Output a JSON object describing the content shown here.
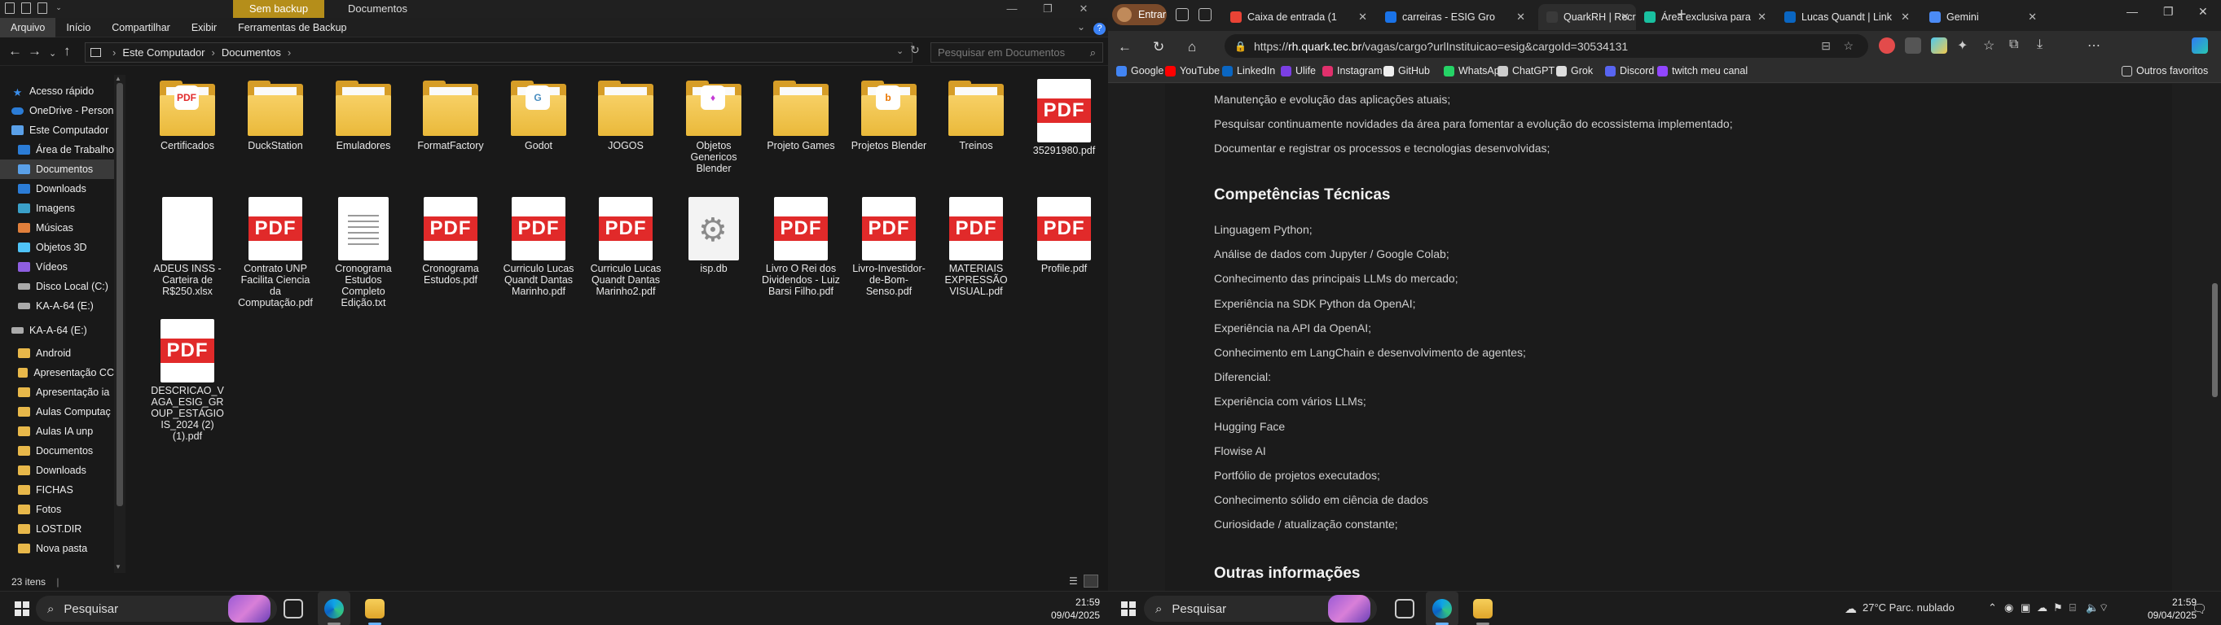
{
  "explorer": {
    "tab_label": "Sem backup",
    "window_title": "Documentos",
    "ribbon": [
      "Arquivo",
      "Início",
      "Compartilhar",
      "Exibir",
      "Ferramentas de Backup"
    ],
    "breadcrumb": [
      "Este Computador",
      "Documentos"
    ],
    "search_placeholder": "Pesquisar em Documentos",
    "status_count": "23 itens",
    "sidebar": [
      {
        "label": "Acesso rápido",
        "icon": "star-icon"
      },
      {
        "label": "OneDrive - Person",
        "icon": "cloud-icon"
      },
      {
        "label": "Este Computador",
        "icon": "computer-icon"
      },
      {
        "label": "Área de Trabalho",
        "icon": "desktop-icon"
      },
      {
        "label": "Documentos",
        "icon": "documents-icon"
      },
      {
        "label": "Downloads",
        "icon": "download-icon"
      },
      {
        "label": "Imagens",
        "icon": "images-icon"
      },
      {
        "label": "Músicas",
        "icon": "music-icon"
      },
      {
        "label": "Objetos 3D",
        "icon": "objects-3d-icon"
      },
      {
        "label": "Vídeos",
        "icon": "video-icon"
      },
      {
        "label": "Disco Local (C:)",
        "icon": "drive-icon"
      },
      {
        "label": "KA-A-64 (E:)",
        "icon": "drive-icon"
      },
      {
        "label": "KA-A-64 (E:)",
        "icon": "drive-icon"
      },
      {
        "label": "Android",
        "icon": "folder-icon"
      },
      {
        "label": "Apresentação CC",
        "icon": "folder-icon"
      },
      {
        "label": "Apresentação ia",
        "icon": "folder-icon"
      },
      {
        "label": "Aulas Computaç",
        "icon": "folder-icon"
      },
      {
        "label": "Aulas IA unp",
        "icon": "folder-icon"
      },
      {
        "label": "Documentos",
        "icon": "folder-icon"
      },
      {
        "label": "Downloads",
        "icon": "folder-icon"
      },
      {
        "label": "FICHAS",
        "icon": "folder-icon"
      },
      {
        "label": "Fotos",
        "icon": "folder-icon"
      },
      {
        "label": "LOST.DIR",
        "icon": "folder-icon"
      },
      {
        "label": "Nova pasta",
        "icon": "folder-icon"
      }
    ],
    "files": [
      {
        "name": "Certificados",
        "kind": "folder",
        "badge": "PDF",
        "badge_color": "#e12a2a"
      },
      {
        "name": "DuckStation",
        "kind": "folder",
        "badge": "",
        "badge_color": ""
      },
      {
        "name": "Emuladores",
        "kind": "folder",
        "badge": "",
        "badge_color": ""
      },
      {
        "name": "FormatFactory",
        "kind": "folder",
        "badge": "",
        "badge_color": ""
      },
      {
        "name": "Godot",
        "kind": "folder",
        "badge": "G",
        "badge_color": "#478cbf"
      },
      {
        "name": "JOGOS",
        "kind": "folder",
        "badge": "",
        "badge_color": ""
      },
      {
        "name": "Objetos Genericos Blender",
        "kind": "folder",
        "badge": "♦",
        "badge_color": "#c43bd6"
      },
      {
        "name": "Projeto Games",
        "kind": "folder",
        "badge": "",
        "badge_color": ""
      },
      {
        "name": "Projetos Blender",
        "kind": "folder",
        "badge": "b",
        "badge_color": "#ea7600"
      },
      {
        "name": "Treinos",
        "kind": "folder",
        "badge": "",
        "badge_color": ""
      },
      {
        "name": "35291980.pdf",
        "kind": "pdf"
      },
      {
        "name": "ADEUS INSS - Carteira de R$250.xlsx",
        "kind": "blank"
      },
      {
        "name": "Contrato UNP Facilita Ciencia da Computação.pdf",
        "kind": "pdf"
      },
      {
        "name": "Cronograma Estudos Completo Edição.txt",
        "kind": "text"
      },
      {
        "name": "Cronograma Estudos.pdf",
        "kind": "pdf"
      },
      {
        "name": "Curriculo Lucas Quandt Dantas Marinho.pdf",
        "kind": "pdf"
      },
      {
        "name": "Curriculo Lucas Quandt Dantas Marinho2.pdf",
        "kind": "pdf"
      },
      {
        "name": "isp.db",
        "kind": "gear"
      },
      {
        "name": "Livro O Rei dos Dividendos - Luiz Barsi Filho.pdf",
        "kind": "pdf"
      },
      {
        "name": "Livro-Investidor-de-Bom-Senso.pdf",
        "kind": "pdf"
      },
      {
        "name": "MATERIAIS EXPRESSÃO VISUAL.pdf",
        "kind": "pdf"
      },
      {
        "name": "Profile.pdf",
        "kind": "pdf"
      },
      {
        "name": "DESCRICAO_VAGA_ESIG_GROUP_ESTÁGIO IS_2024 (2) (1).pdf",
        "kind": "pdf"
      }
    ],
    "pdf_label": "PDF"
  },
  "browser": {
    "signin_label": "Entrar",
    "tabs": [
      {
        "title": "Caixa de entrada (1",
        "color": "#ea4335"
      },
      {
        "title": "carreiras - ESIG Gro",
        "color": "#1a73e8"
      },
      {
        "title": "QuarkRH | Recrutame",
        "color": "#3a3a3a"
      },
      {
        "title": "Área exclusiva para",
        "color": "#19c0a0"
      },
      {
        "title": "Lucas Quandt | Link",
        "color": "#0a66c2"
      },
      {
        "title": "Gemini",
        "color": "#4b8bf5"
      }
    ],
    "url_prefix": "https://",
    "url_host": "rh.quark.tec.br",
    "url_path": "/vagas/cargo?urlInstituicao=esig&cargoId=30534131",
    "favorites": [
      {
        "label": "Google",
        "color": "#4285f4"
      },
      {
        "label": "YouTube",
        "color": "#ff0000"
      },
      {
        "label": "LinkedIn",
        "color": "#0a66c2"
      },
      {
        "label": "Ulife",
        "color": "#7b3fe4"
      },
      {
        "label": "Instagram",
        "color": "#e1306c"
      },
      {
        "label": "GitHub",
        "color": "#eeeeee"
      },
      {
        "label": "WhatsApp",
        "color": "#25d366"
      },
      {
        "label": "ChatGPT",
        "color": "#cccccc"
      },
      {
        "label": "Grok",
        "color": "#dddddd"
      },
      {
        "label": "Discord",
        "color": "#5865f2"
      },
      {
        "label": "twitch meu canal",
        "color": "#9146ff"
      }
    ],
    "other_favorites": "Outros favoritos",
    "page": {
      "top_lines": [
        "Manutenção e evolução das aplicações atuais;",
        "Pesquisar continuamente novidades da área para fomentar a evolução do ecossistema implementado;",
        "Documentar e registrar os processos e tecnologias desenvolvidas;"
      ],
      "heading_skills": "Competências Técnicas",
      "skills": [
        "Linguagem Python;",
        "Análise de dados com Jupyter / Google Colab;",
        "Conhecimento das principais LLMs do mercado;",
        "Experiência na SDK Python da OpenAI;",
        "Experiência na API da OpenAI;",
        "Conhecimento em LangChain e desenvolvimento de agentes;",
        "Diferencial:",
        "Experiência com vários LLMs;",
        "Hugging Face",
        "Flowise AI",
        "Portfólio de projetos executados;",
        "Conhecimento sólido em ciência de dados",
        "Curiosidade / atualização constante;"
      ],
      "heading_other": "Outras informações"
    }
  },
  "taskbar": {
    "search_label": "Pesquisar",
    "time": "21:59",
    "date": "09/04/2025",
    "weather": "27°C  Parc. nublado"
  }
}
